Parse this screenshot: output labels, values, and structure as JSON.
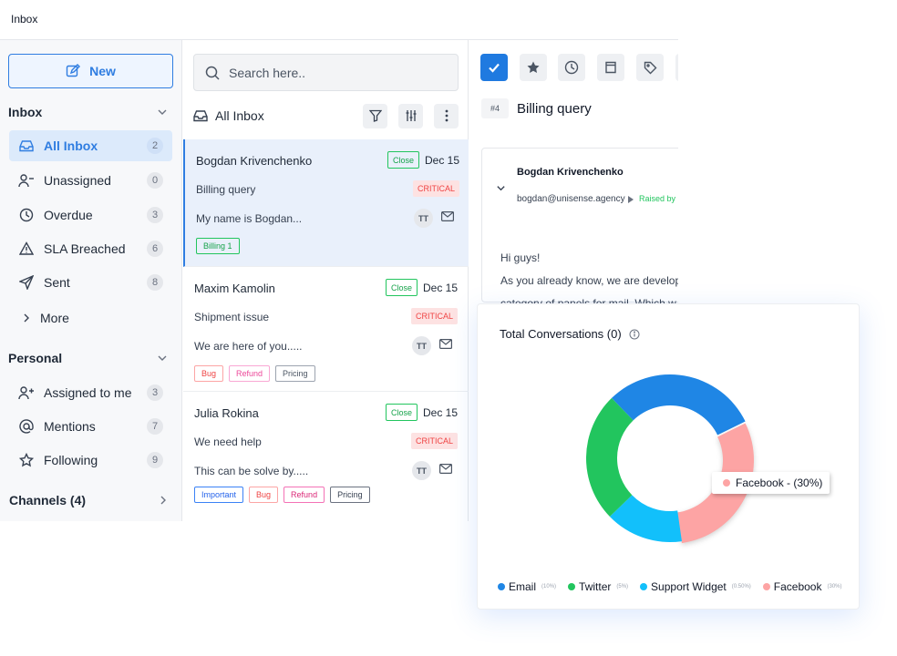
{
  "topbar": {
    "title": "Inbox"
  },
  "sidebar": {
    "new_label": "New",
    "inbox_section": "Inbox",
    "inbox_items": [
      {
        "label": "All Inbox",
        "count": "2",
        "icon": "inbox-icon"
      },
      {
        "label": "Unassigned",
        "count": "0",
        "icon": "user-minus-icon"
      },
      {
        "label": "Overdue",
        "count": "3",
        "icon": "clock-icon"
      },
      {
        "label": "SLA Breached",
        "count": "6",
        "icon": "warning-icon"
      },
      {
        "label": "Sent",
        "count": "8",
        "icon": "send-icon"
      }
    ],
    "more_label": "More",
    "personal_section": "Personal",
    "personal_items": [
      {
        "label": "Assigned to me",
        "count": "3",
        "icon": "user-plus-icon"
      },
      {
        "label": "Mentions",
        "count": "7",
        "icon": "at-icon"
      },
      {
        "label": "Following",
        "count": "9",
        "icon": "star-icon"
      }
    ],
    "channels_label": "Channels (4)"
  },
  "list": {
    "search_placeholder": "Search here..",
    "header_title": "All Inbox",
    "conversations": [
      {
        "name": "Bogdan Krivenchenko",
        "status": "Close",
        "date": "Dec 15",
        "subject": "Billing query",
        "priority": "CRITICAL",
        "preview": "My name is Bogdan...",
        "avatar": "TT",
        "tags": [
          {
            "label": "Billing 1",
            "color": "#22c55e"
          }
        ]
      },
      {
        "name": "Maxim Kamolin",
        "status": "Close",
        "date": "Dec 15",
        "subject": "Shipment issue",
        "priority": "CRITICAL",
        "preview": "We are here of you.....",
        "avatar": "TT",
        "tags": [
          {
            "label": "Bug",
            "color": "#f87171"
          },
          {
            "label": "Refund",
            "color": "#ec4899"
          },
          {
            "label": "Pricing",
            "color": "#6b7280"
          }
        ]
      },
      {
        "name": "Julia Rokina",
        "status": "Close",
        "date": "Dec 15",
        "subject": "We need help",
        "priority": "CRITICAL",
        "preview": "This can be solve by.....",
        "avatar": "TT",
        "tags": [
          {
            "label": "Important",
            "color": "#2563eb"
          },
          {
            "label": "Bug",
            "color": "#f87171"
          },
          {
            "label": "Refund",
            "color": "#ec4899"
          },
          {
            "label": "Pricing",
            "color": "#4b5563"
          }
        ]
      }
    ]
  },
  "detail": {
    "ticket_no": "#4",
    "ticket_title": "Billing query",
    "sender": "Bogdan Krivenchenko",
    "email": "bogdan@unisense.agency",
    "raised_by": "Raised by",
    "greeting": "Hi guys!",
    "line1": "As you already know, we are develop",
    "line2": "category of panels for mail. Which w"
  },
  "chart_card": {
    "title": "Total Conversations (0)",
    "tooltip": "Facebook - (30%)"
  },
  "chart_data": {
    "type": "pie",
    "title": "Total Conversations (0)",
    "series": [
      {
        "name": "Email",
        "value": 30,
        "color": "#1f86e5",
        "legend_pct": "(10%)"
      },
      {
        "name": "Facebook",
        "value": 30,
        "color": "#fda4a4",
        "legend_pct": "(30%)"
      },
      {
        "name": "Support Widget",
        "value": 15,
        "color": "#12c0fb",
        "legend_pct": "(0.50%)"
      },
      {
        "name": "Twitter",
        "value": 25,
        "color": "#22c55e",
        "legend_pct": "(5%)"
      }
    ],
    "legend_order": [
      "Email",
      "Twitter",
      "Support Widget",
      "Facebook"
    ],
    "legend_placement": "bottom",
    "donut": true
  }
}
